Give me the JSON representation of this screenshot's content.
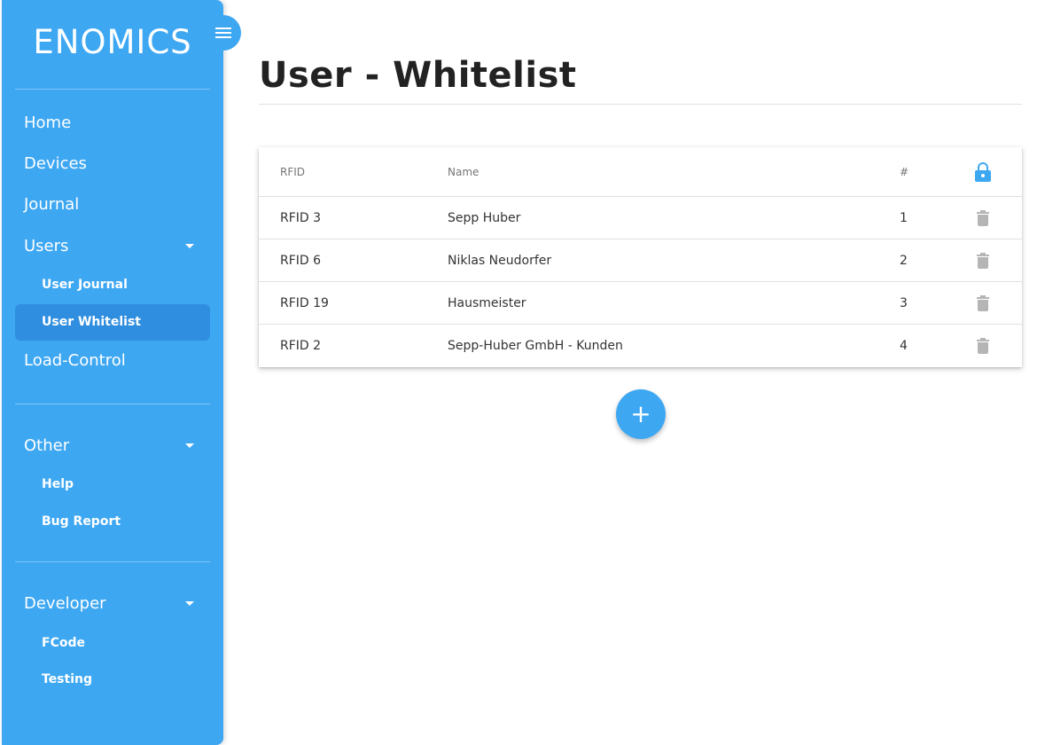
{
  "brand": {
    "logo_text": "ENOMICS"
  },
  "sidebar": {
    "items": [
      {
        "label": "Home"
      },
      {
        "label": "Devices"
      },
      {
        "label": "Journal"
      },
      {
        "label": "Users"
      },
      {
        "label": "Load-Control"
      }
    ],
    "users_sub": [
      {
        "label": "User Journal"
      },
      {
        "label": "User Whitelist",
        "active": true
      }
    ],
    "other": {
      "label": "Other",
      "sub": [
        {
          "label": "Help"
        },
        {
          "label": "Bug Report"
        }
      ]
    },
    "developer": {
      "label": "Developer",
      "sub": [
        {
          "label": "FCode"
        },
        {
          "label": "Testing"
        }
      ]
    }
  },
  "page": {
    "title": "User - Whitelist"
  },
  "table": {
    "columns": {
      "rfid": "RFID",
      "name": "Name",
      "num": "#"
    },
    "header_icon": "lock-icon",
    "rows": [
      {
        "rfid": "RFID 3",
        "name": "Sepp Huber",
        "num": "1"
      },
      {
        "rfid": "RFID 6",
        "name": "Niklas Neudorfer",
        "num": "2"
      },
      {
        "rfid": "RFID 19",
        "name": "Hausmeister",
        "num": "3"
      },
      {
        "rfid": "RFID 2",
        "name": "Sepp-Huber GmbH - Kunden",
        "num": "4"
      }
    ],
    "row_action_icon": "trash-icon"
  },
  "fab": {
    "label": "+"
  },
  "colors": {
    "accent": "#3ea7f2",
    "active_item": "#2f8ee0",
    "icon_muted": "#b5b5b5"
  }
}
